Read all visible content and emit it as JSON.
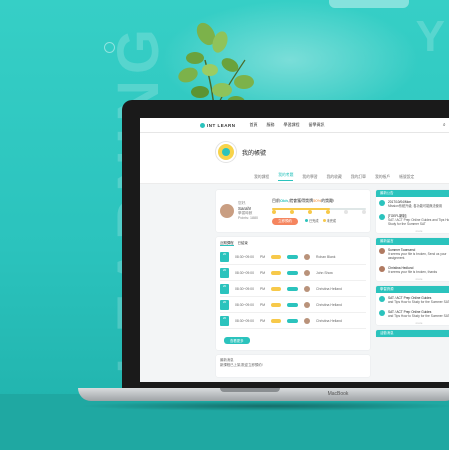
{
  "background": {
    "vertical_text": "E-LEARNING",
    "corner_letter": "Y"
  },
  "laptop": {
    "brand": "MacBook"
  },
  "nav": {
    "logo": "INT LEARN",
    "items": [
      "首頁",
      "服務",
      "學習課程",
      "留學資訊"
    ],
    "right_icons": [
      "search-icon",
      "user-icon"
    ]
  },
  "profile": {
    "title": "我的帳號"
  },
  "tabs": [
    "我的課程",
    "我的考題",
    "我的學習",
    "我的收藏",
    "我的訂單",
    "我的帳戶",
    "帳號設定"
  ],
  "user_card": {
    "greeting": "您好,",
    "name": "Sarah!",
    "meta1": "學習時數",
    "meta2": "Points: 1880",
    "goal_prefix": "目前",
    "goal_highlight": "Obh",
    "goal_mid": ",就會獲得獎牌",
    "goal_orange": "50%",
    "goal_suffix": "的獎勵!",
    "progress": 0.62,
    "button": "立即預約",
    "legend": [
      {
        "label": "已完成",
        "color": "#2bc3bd"
      },
      {
        "label": "未完成",
        "color": "#f7c94a"
      }
    ]
  },
  "schedule": {
    "tabs": [
      "近期課程",
      "已結束"
    ],
    "rows": [
      {
        "day": "20",
        "time": "08:30~09:00",
        "type": "PM",
        "name": "Rohan Blank"
      },
      {
        "day": "20",
        "time": "08:30~09:00",
        "type": "PM",
        "name": "John Show"
      },
      {
        "day": "20",
        "time": "08:30~09:00",
        "type": "PM",
        "name": "Christina Helland"
      },
      {
        "day": "20",
        "time": "08:30~09:00",
        "type": "PM",
        "name": "Christina Helland"
      },
      {
        "day": "20",
        "time": "08:30~09:00",
        "type": "PM",
        "name": "Christina Helland"
      }
    ],
    "button": "查看更多"
  },
  "bottom_card": {
    "title": "最新消息",
    "text": "新課程已上架,歡迎立即預約!"
  },
  "right_panels": [
    {
      "header": "最新公告",
      "items": [
        {
          "title": "2017/10/04/Mon",
          "text": "Mission系統升級, 各功能可能無法使用"
        },
        {
          "title": "[TOEFL新制]",
          "text": "SAT / ACT Prep Online Guides and Tips How to Study for the Summer SAT"
        }
      ]
    },
    {
      "header": "最新留言",
      "items": [
        {
          "title": "Summer Townsend",
          "text": "It seems your file is broken, Send us your assignment."
        },
        {
          "title": "Christina Hedlund",
          "text": "It seems your file is broken, thanks"
        }
      ]
    },
    {
      "header": "學習資源",
      "items": [
        {
          "title": "SAT / ACT Prep Online Guides",
          "text": "and Tips How to Study for the Summer SAT"
        },
        {
          "title": "SAT / ACT Prep Online Guides",
          "text": "and Tips How to Study for the Summer SAT"
        }
      ]
    },
    {
      "header": "活動消息",
      "items": []
    }
  ],
  "more_label": "more"
}
